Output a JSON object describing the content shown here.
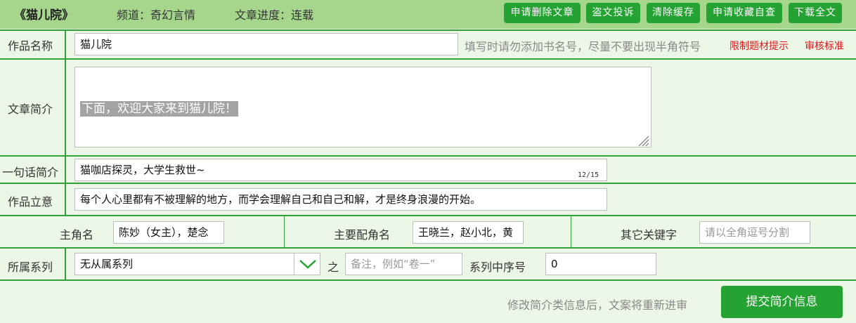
{
  "header": {
    "book_title": "《猫儿院》",
    "channel": "频道：奇幻言情",
    "progress": "文章进度：连载",
    "buttons": [
      "申请删除文章",
      "盗文投诉",
      "清除缓存",
      "申请收藏自查",
      "下载全文"
    ]
  },
  "work_name": {
    "label": "作品名称",
    "value": "猫儿院",
    "hint": "填写时请勿添加书名号，尽量不要出现半角符号",
    "link_restrict": "限制题材提示",
    "link_review": "审核标准"
  },
  "summary": {
    "label": "文章简介",
    "value": "下面，欢迎大家来到猫儿院！"
  },
  "one_line": {
    "label": "一句话简介",
    "value": "猫咖店探灵，大学生救世~",
    "counter": "12/15"
  },
  "theme": {
    "label": "作品立意",
    "value": "每个人心里都有不被理解的地方，而学会理解自己和自己和解，才是终身浪漫的开始。"
  },
  "characters": {
    "protagonist_label": "主角名",
    "protagonist_value": "陈妙（女主），楚念",
    "supporting_label": "主要配角名",
    "supporting_value": "王晓兰，赵小北，黄",
    "other_label": "其它关键字",
    "other_placeholder": "请以全角逗号分割"
  },
  "series": {
    "label": "所属系列",
    "selected": "无从属系列",
    "connector": "之",
    "note_placeholder": "备注，例如“卷一”",
    "order_label": "系列中序号",
    "order_value": "0"
  },
  "footer": {
    "notice": "修改简介类信息后，文案将重新进审",
    "submit_label": "提交简介信息"
  },
  "colors": {
    "header_bg": "#a5d68c",
    "page_bg": "#ebf6e6",
    "accent_green": "#25a332",
    "link_red": "#e0181d"
  }
}
